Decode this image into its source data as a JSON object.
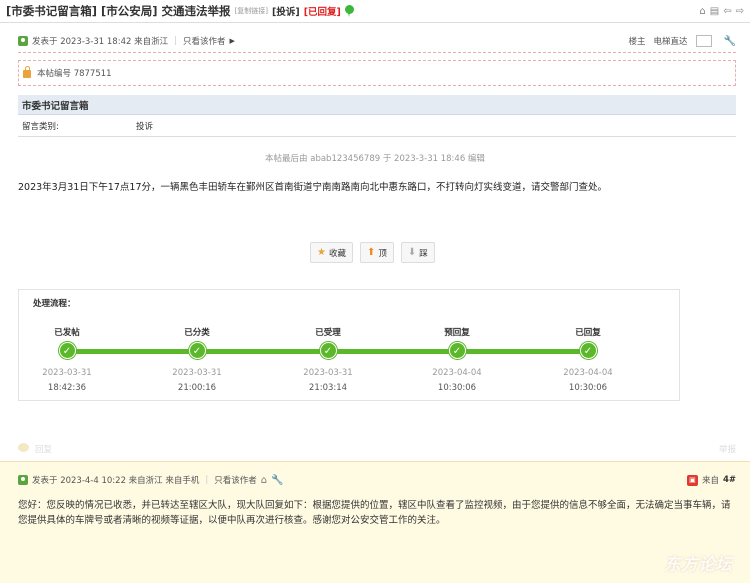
{
  "header": {
    "title": "[市委书记留言箱] [市公安局] 交通违法举报",
    "copy_link": "[复制链接]",
    "tag_complaint": "[投诉]",
    "tag_replied": "[已回复]"
  },
  "post": {
    "meta_prefix": "发表于 2023-3-31 18:42 来自浙江",
    "only_author": "只看该作者",
    "floor_host": "楼主",
    "elevator": "电梯直达",
    "post_id": "本帖编号 7877511",
    "box_title": "市委书记留言箱",
    "category_key": "留言类别:",
    "category_value": "投诉",
    "edit_note": "本帖最后由 abab123456789 于 2023-3-31 18:46 编辑",
    "body": "2023年3月31日下午17点17分，一辆黑色丰田轿车在鄞州区首南街道宁南南路南向北中惠东路口，不打转向灯实线变道，请交警部门查处。"
  },
  "actions": {
    "favorite": "收藏",
    "up": "顶",
    "down": "踩"
  },
  "flow": {
    "title": "处理流程：",
    "steps": [
      {
        "label": "已发帖",
        "date": "2023-03-31",
        "time": "18:42:36"
      },
      {
        "label": "已分类",
        "date": "2023-03-31",
        "time": "21:00:16"
      },
      {
        "label": "已受理",
        "date": "2023-03-31",
        "time": "21:03:14"
      },
      {
        "label": "预回复",
        "date": "2023-04-04",
        "time": "10:30:06"
      },
      {
        "label": "已回复",
        "date": "2023-04-04",
        "time": "10:30:06"
      }
    ]
  },
  "reply_bar": {
    "reply": "回复",
    "report": "举报"
  },
  "second_post": {
    "meta": "发表于 2023-4-4 10:22 来自浙江 来自手机",
    "only_author": "只看该作者",
    "source": "来自",
    "floor": "4#",
    "body": "您好：您反映的情况已收悉，并已转达至辖区大队，现大队回复如下：根据您提供的位置，辖区中队查看了监控视频，由于您提供的信息不够全面，无法确定当事车辆，请您提供具体的车牌号或者清晰的视频等证据，以便中队再次进行核查。感谢您对公安交管工作的关注。"
  },
  "watermark": "东方论坛",
  "colors": {
    "accent_green": "#5bb82a",
    "replied_red": "#e02020",
    "box_head_bg": "#e4ebf3",
    "reply_bg": "#fffbe3"
  }
}
